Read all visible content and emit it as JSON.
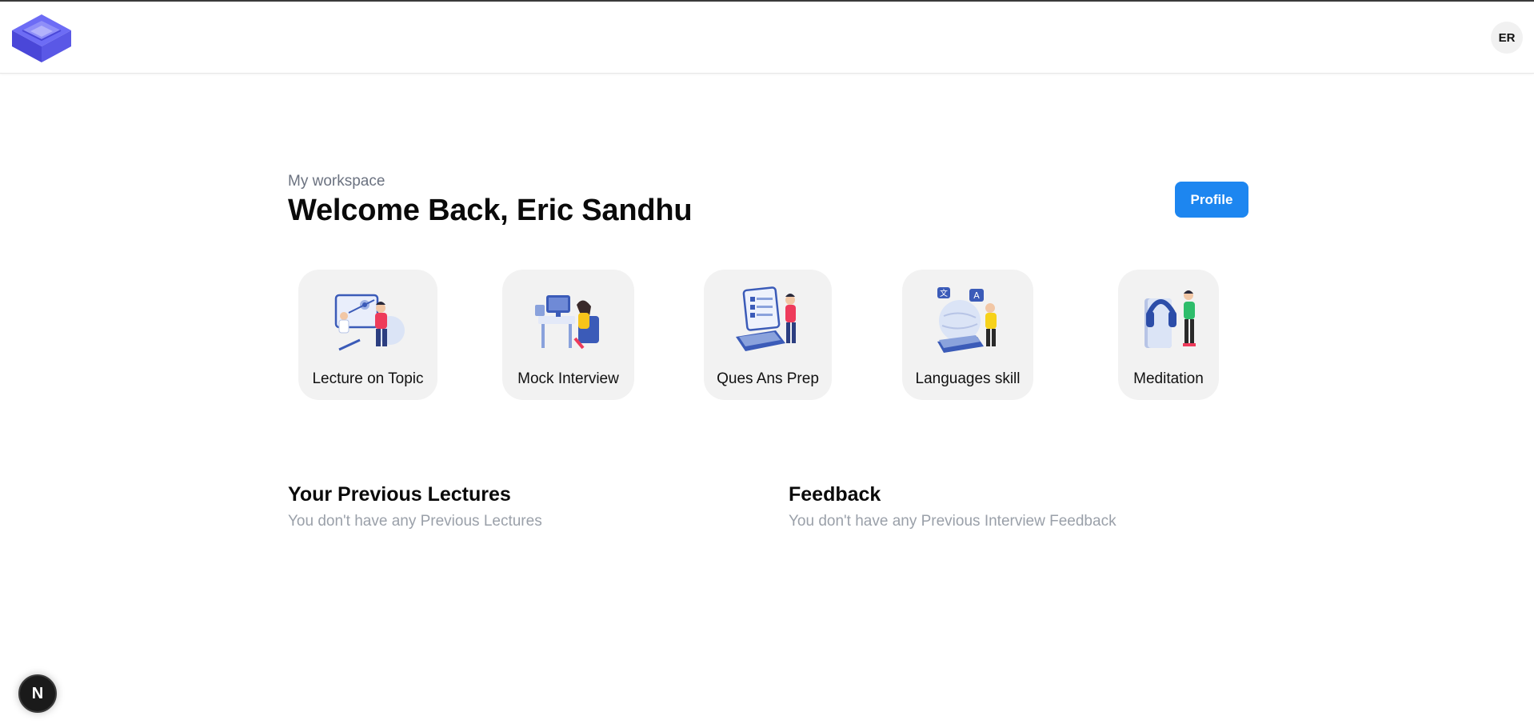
{
  "header": {
    "logo_icon": "stacked-layers-logo",
    "avatar_initials": "ER"
  },
  "workspace": {
    "subtitle": "My workspace",
    "welcome": "Welcome Back, Eric Sandhu",
    "profile_button": "Profile"
  },
  "cards": [
    {
      "label": "Lecture on Topic",
      "icon": "lecture-illustration"
    },
    {
      "label": "Mock Interview",
      "icon": "interview-illustration"
    },
    {
      "label": "Ques Ans Prep",
      "icon": "qa-illustration"
    },
    {
      "label": "Languages skill",
      "icon": "languages-illustration"
    },
    {
      "label": "Meditation",
      "icon": "meditation-illustration"
    }
  ],
  "lectures": {
    "title": "Your Previous Lectures",
    "empty": "You don't have any Previous Lectures"
  },
  "feedback": {
    "title": "Feedback",
    "empty": "You don't have any Previous Interview Feedback"
  },
  "dev_badge": {
    "text": "N"
  },
  "colors": {
    "accent": "#1d86f0",
    "logo": "#5b5bf0",
    "card_bg": "#f2f2f2"
  }
}
